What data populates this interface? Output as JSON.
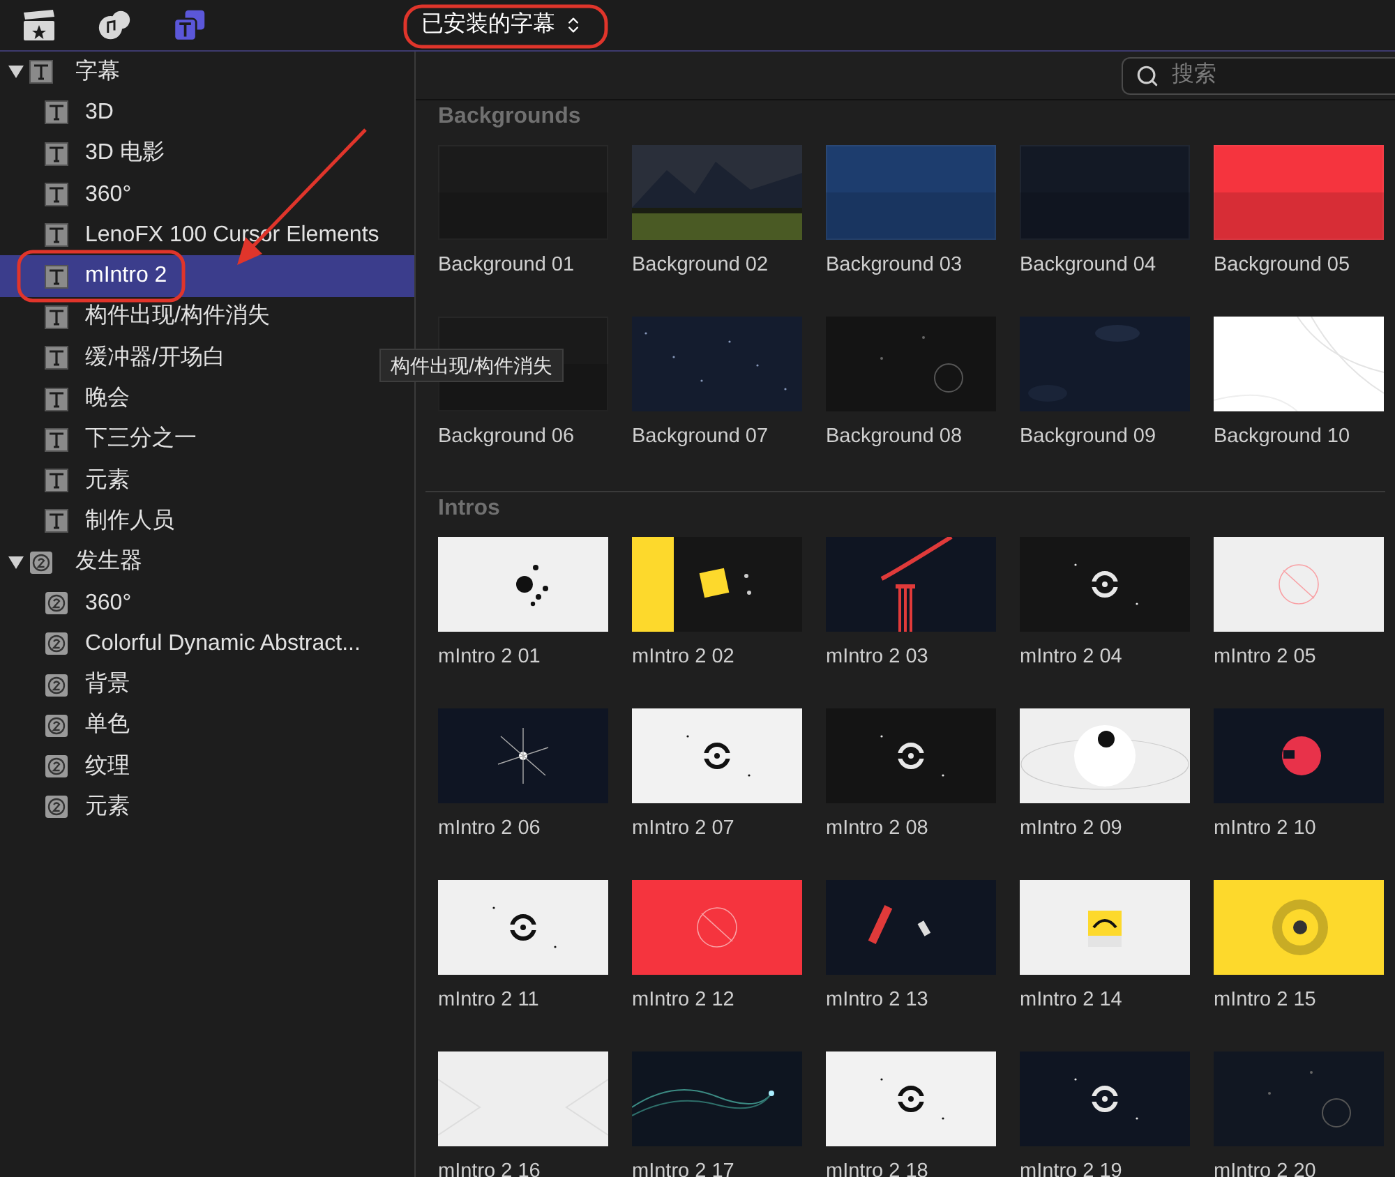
{
  "toolbar": {
    "buttons": [
      {
        "kind": "clapper",
        "selected": false
      },
      {
        "kind": "media",
        "selected": false
      },
      {
        "kind": "titles",
        "selected": true
      }
    ]
  },
  "library_menu": {
    "label": "已安装的字幕"
  },
  "sidebar": {
    "groups": [
      {
        "label": "字幕",
        "kind": "title",
        "expanded": true,
        "children": [
          {
            "label": "3D",
            "selected": false
          },
          {
            "label": "3D 电影",
            "selected": false
          },
          {
            "label": "360°",
            "selected": false
          },
          {
            "label": "LenoFX 100 Cursor Elements",
            "selected": false
          },
          {
            "label": "mIntro 2",
            "selected": true
          },
          {
            "label": "构件出现/构件消失",
            "selected": false
          },
          {
            "label": "缓冲器/开场白",
            "selected": false
          },
          {
            "label": "晚会",
            "selected": false
          },
          {
            "label": "下三分之一",
            "selected": false
          },
          {
            "label": "元素",
            "selected": false
          },
          {
            "label": "制作人员",
            "selected": false
          }
        ]
      },
      {
        "label": "发生器",
        "kind": "generator",
        "expanded": true,
        "children": [
          {
            "label": "360°",
            "selected": false
          },
          {
            "label": "Colorful Dynamic Abstract...",
            "selected": false
          },
          {
            "label": "背景",
            "selected": false
          },
          {
            "label": "单色",
            "selected": false
          },
          {
            "label": "纹理",
            "selected": false
          },
          {
            "label": "元素",
            "selected": false
          }
        ]
      }
    ]
  },
  "search": {
    "placeholder": "搜索"
  },
  "sections": [
    {
      "title": "Backgrounds",
      "items": [
        {
          "label": "Background 01"
        },
        {
          "label": "Background 02"
        },
        {
          "label": "Background 03"
        },
        {
          "label": "Background 04"
        },
        {
          "label": "Background 05"
        },
        {
          "label": "Background 06"
        },
        {
          "label": "Background 07"
        },
        {
          "label": "Background 08"
        },
        {
          "label": "Background 09"
        },
        {
          "label": "Background 10"
        }
      ]
    },
    {
      "title": "Intros",
      "items": [
        {
          "label": "mIntro 2 01"
        },
        {
          "label": "mIntro 2 02"
        },
        {
          "label": "mIntro 2 03"
        },
        {
          "label": "mIntro 2 04"
        },
        {
          "label": "mIntro 2 05"
        },
        {
          "label": "mIntro 2 06"
        },
        {
          "label": "mIntro 2 07"
        },
        {
          "label": "mIntro 2 08"
        },
        {
          "label": "mIntro 2 09"
        },
        {
          "label": "mIntro 2 10"
        },
        {
          "label": "mIntro 2 11"
        },
        {
          "label": "mIntro 2 12"
        },
        {
          "label": "mIntro 2 13"
        },
        {
          "label": "mIntro 2 14"
        },
        {
          "label": "mIntro 2 15"
        },
        {
          "label": "mIntro 2 16"
        },
        {
          "label": "mIntro 2 17"
        },
        {
          "label": "mIntro 2 18"
        },
        {
          "label": "mIntro 2 19"
        },
        {
          "label": "mIntro 2 20"
        }
      ]
    }
  ],
  "tooltip": {
    "text": "构件出现/构件消失"
  }
}
